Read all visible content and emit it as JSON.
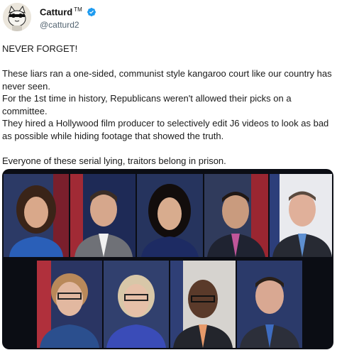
{
  "tweet": {
    "display_name": "Catturd",
    "tm": "TM",
    "handle": "@catturd2",
    "avatar_icon": "cat-avatar-icon",
    "verified_icon": "verified-badge-icon",
    "headline": "NEVER FORGET!",
    "paragraph_lines": [
      "These liars ran a one-sided, communist style kangaroo court like our country has never seen.",
      "For the 1st time in history, Republicans weren't allowed their picks on a committee.",
      "They hired a Hollywood film producer to selectively edit J6 videos to look as bad as possible while hiding footage that showed the truth."
    ],
    "closing": "Everyone of these serial lying, traitors belong in prison."
  },
  "colors": {
    "verified_blue": "#1d9bf0",
    "text": "#0f1419",
    "handle_gray": "#536471",
    "media_bg": "#0b0d14"
  },
  "media": {
    "photo_count": 9
  }
}
